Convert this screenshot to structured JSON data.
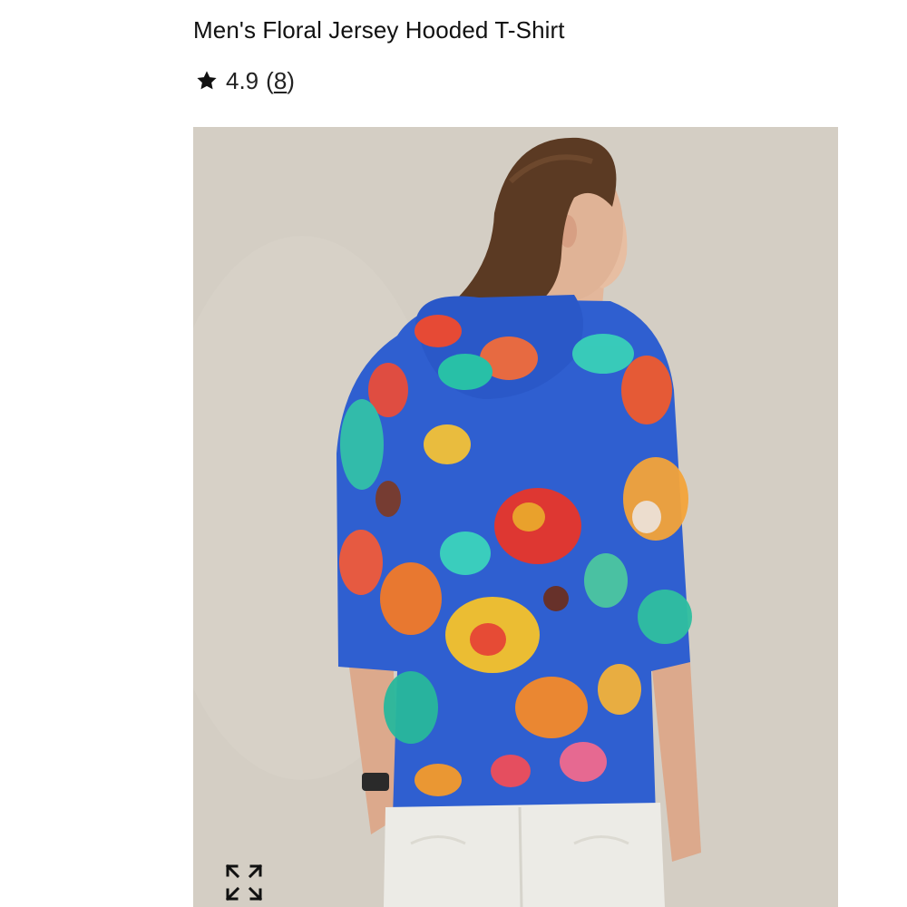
{
  "product": {
    "title": "Men's Floral Jersey Hooded T-Shirt",
    "rating": {
      "value": "4.9",
      "open_paren": "(",
      "count": "8",
      "close_paren": ")",
      "icon": "star-icon"
    }
  },
  "gallery": {
    "image_subject": "model-back-view-floral-hoodie",
    "expand_icon": "expand-icon"
  },
  "colors": {
    "text": "#111111",
    "image_background": "#d4cec4",
    "shirt_base": "#2f5fd0",
    "pants": "#ecebe6"
  }
}
